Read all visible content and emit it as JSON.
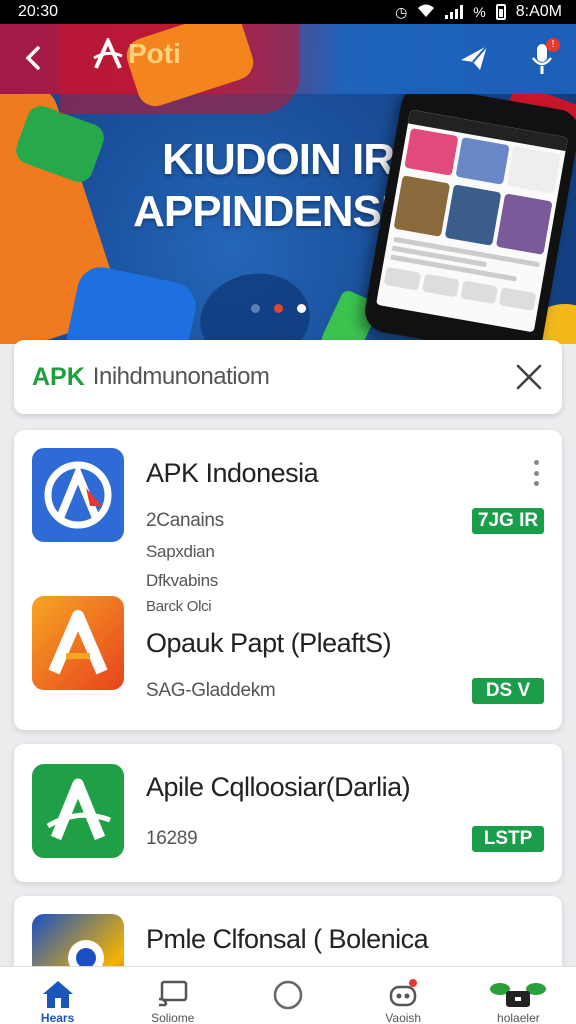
{
  "status_bar": {
    "time": "20:30",
    "battery_text": "%",
    "clock_right": "8:A0M"
  },
  "header": {
    "back_icon": "back-arrow-icon",
    "brand_text": "Poti",
    "actions": [
      "send-icon",
      "microphone-icon"
    ]
  },
  "banner": {
    "title_line1": "KIUDOIN IR",
    "title_line2": "APPINDENSIA",
    "carousel_dots": 3,
    "active_dot": 2
  },
  "search": {
    "prefix": "APK",
    "text": "Inihdmunonatiom",
    "clear_icon": "close-icon"
  },
  "apps": [
    {
      "name": "APK Indonesia",
      "meta": [
        "2Canains",
        "Sapxdian",
        "Dfkvabins",
        "Barck Olci"
      ],
      "badge": "7JG IR",
      "color": "#2f6bd6"
    },
    {
      "name": "Opauk Papt (PleaftS)",
      "meta": [
        "SAG-Gladdekm"
      ],
      "badge": "DS V",
      "color": "#f07e1c"
    },
    {
      "name": "Apile Cqlloosiar(Darlia)",
      "meta": [
        "16289"
      ],
      "badge": "LSTP",
      "color": "#1fa046"
    },
    {
      "name": "Pmle Clfonsal  ( Bolenica",
      "meta": [],
      "badge": "",
      "color": "#1b50c4"
    }
  ],
  "bottom_nav": [
    {
      "label": "Hears",
      "icon": "home-icon",
      "active": true
    },
    {
      "label": "Soliome",
      "icon": "cast-icon",
      "active": false
    },
    {
      "label": "",
      "icon": "circle-icon",
      "active": false
    },
    {
      "label": "Vaoish",
      "icon": "robot-icon",
      "active": false
    },
    {
      "label": "holaeler",
      "icon": "folder-icon",
      "active": false
    }
  ]
}
